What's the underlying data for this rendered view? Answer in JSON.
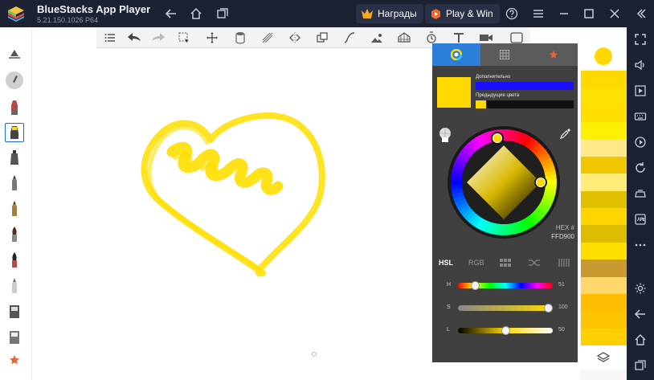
{
  "window": {
    "title": "BlueStacks App Player",
    "version": "5.21.150.1026 P64",
    "rewards_label": "Награды",
    "playwin_label": "Play & Win"
  },
  "colors": {
    "selected": "#ffd900",
    "previous": "#ffd900",
    "extra": "#1a10ff",
    "accent": "#2c7fd8"
  },
  "color_panel": {
    "tabs": [
      "color-wheel-icon",
      "grid-icon",
      "star-icon"
    ],
    "extra_label": "Дополнительно",
    "previous_label": "Предыдущие цвета",
    "hex_label": "HEX #",
    "hex_value": "FFD900",
    "modes": [
      "HSL",
      "RGB"
    ],
    "active_mode": "HSL",
    "sliders": [
      {
        "label": "H",
        "value": "51"
      },
      {
        "label": "S",
        "value": "100"
      },
      {
        "label": "L",
        "value": "50"
      }
    ]
  },
  "palette": {
    "swatches": [
      "#ffd900",
      "#ffe100",
      "#ffde00",
      "#ffef00",
      "#ffe98a",
      "#f0c700",
      "#ffec79",
      "#e0c000",
      "#ffd500",
      "#dcbd00",
      "#ffdf00",
      "#c99a30",
      "#ffd76b",
      "#ffbd00",
      "#ffc400",
      "#ffd000"
    ]
  }
}
